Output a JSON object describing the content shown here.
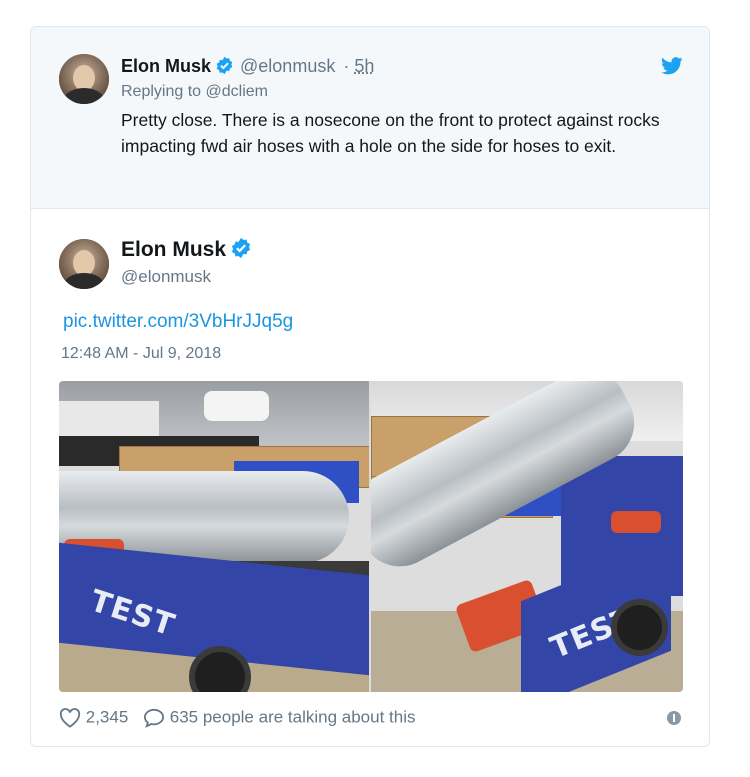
{
  "parent_tweet": {
    "name": "Elon Musk",
    "handle": "@elonmusk",
    "separator": "·",
    "time": "5h",
    "replying_prefix": "Replying to",
    "replying_to": "@dcliem",
    "text": "Pretty close. There is a nosecone on the front to protect against rocks impacting fwd air hoses with a hole on the side for hoses to exit."
  },
  "main_tweet": {
    "name": "Elon Musk",
    "handle": "@elonmusk",
    "link": "pic.twitter.com/3VbHrJJq5g",
    "timestamp": "12:48 AM - Jul 9, 2018"
  },
  "photos": {
    "left_cart_label": "TEST",
    "right_cart_label": "TEST"
  },
  "footer": {
    "likes": "2,345",
    "talking": "635 people are talking about this"
  },
  "colors": {
    "twitter_blue": "#1da1f2",
    "link_blue": "#1b95e0",
    "muted_gray": "#657786",
    "parent_bg": "#f5f8fa"
  },
  "icons": [
    "verified-badge-icon",
    "twitter-bird-icon",
    "heart-icon",
    "comment-bubble-icon",
    "info-icon"
  ]
}
